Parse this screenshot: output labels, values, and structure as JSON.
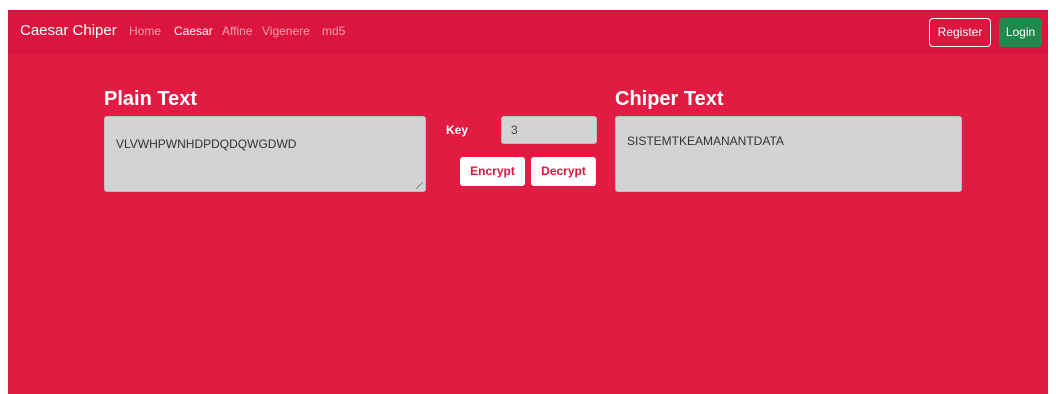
{
  "navbar": {
    "brand": "Caesar Chiper",
    "links": [
      {
        "label": "Home",
        "active": false
      },
      {
        "label": "Caesar",
        "active": true
      },
      {
        "label": "Affine",
        "active": false
      },
      {
        "label": "Vigenere",
        "active": false
      },
      {
        "label": "md5",
        "active": false
      }
    ],
    "register_label": "Register",
    "login_label": "Login"
  },
  "plain": {
    "heading": "Plain Text",
    "value": "VLVWHPWNHDPDQDQWGDWD"
  },
  "key": {
    "label": "Key",
    "value": "3"
  },
  "actions": {
    "encrypt_label": "Encrypt",
    "decrypt_label": "Decrypt"
  },
  "cipher": {
    "heading": "Chiper Text",
    "value": "SISTEMTKEAMANANTDATA"
  },
  "colors": {
    "background": "#e21b43",
    "navbar": "#dc153e",
    "login_button": "#1f8a4c",
    "field": "#d3d3d3"
  }
}
